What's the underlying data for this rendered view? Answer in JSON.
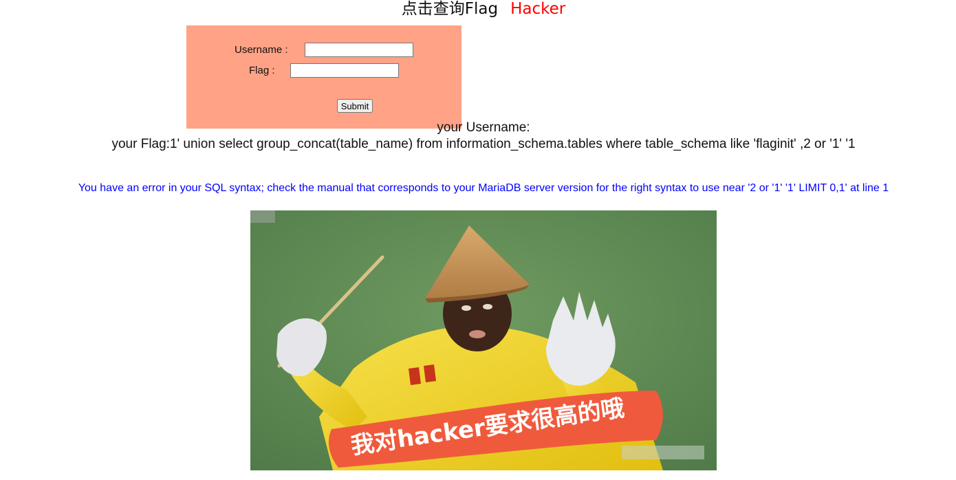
{
  "header": {
    "title": "点击查询Flag",
    "hacker": "Hacker"
  },
  "form": {
    "username_label": "Username :",
    "username_value": "",
    "flag_label": "Flag :",
    "flag_value": "",
    "submit_label": "Submit"
  },
  "result": {
    "username_line": "your Username:",
    "flag_line": "your Flag:1' union select group_concat(table_name) from information_schema.tables where table_schema like 'flaginit' ,2 or '1' '1"
  },
  "error": {
    "message": "You have an error in your SQL syntax; check the manual that corresponds to your MariaDB server version for the right syntax to use near '2 or '1' '1' LIMIT 0,1' at line 1"
  },
  "meme": {
    "caption": "我对hacker要求很高的哦",
    "colors": {
      "grass": "#5f8a55",
      "jersey": "#f0d21e",
      "banner": "#f05a3c",
      "hat": "#c8955a"
    }
  }
}
